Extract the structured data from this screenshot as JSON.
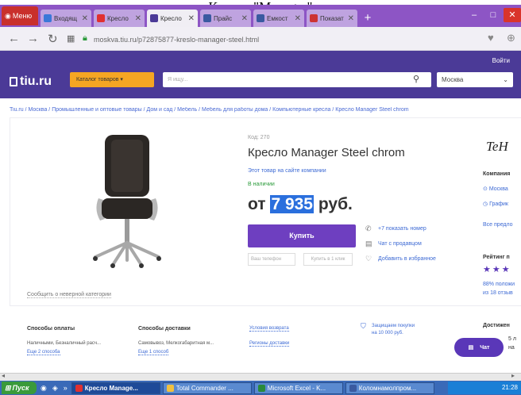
{
  "caption": "Кресло \"Manager\"",
  "browser": {
    "menu_label": "Меню",
    "tabs": [
      {
        "label": "Входящ",
        "active": false,
        "color": "#3b78d8"
      },
      {
        "label": "Кресло",
        "active": false,
        "color": "#e03030"
      },
      {
        "label": "Кресло",
        "active": true,
        "color": "#4b3a97"
      },
      {
        "label": "Прайс",
        "active": false,
        "color": "#3a5aa0"
      },
      {
        "label": "Емкост",
        "active": false,
        "color": "#3a5aa0"
      },
      {
        "label": "Показат",
        "active": false,
        "color": "#cc3333"
      }
    ],
    "new_tab": "+",
    "url": "moskva.tiu.ru/p72875877-kreslo-manager-steel.html"
  },
  "site": {
    "login": "Войти",
    "logo": "tiu.ru",
    "catalog_label": "Каталог товаров",
    "search_placeholder": "Я ищу...",
    "city": "Москва",
    "breadcrumb": "Tiu.ru / Москва / Промышленные и оптовые товары / Дом и сад / Мебель / Мебель для работы дома / Компьютерные кресла / Кресло Manager Steel chrom"
  },
  "product": {
    "code": "Код: 270",
    "title": "Кресло Manager Steel chrom",
    "on_site": "Этот товар на сайте компании",
    "availability": "В наличии",
    "price_prefix": "от",
    "price_value": "7 935",
    "price_currency": "руб.",
    "buy_label": "Купить",
    "phone_placeholder": "Ваш телефон",
    "one_click": "Купить в 1 клик",
    "actions": [
      {
        "icon": "phone-icon",
        "glyph": "✆",
        "label": "+7 показать номер"
      },
      {
        "icon": "chat-icon",
        "glyph": "▤",
        "label": "Чат с продавцом"
      },
      {
        "icon": "heart-icon",
        "glyph": "♡",
        "label": "Добавить в избранное"
      }
    ],
    "report": "Сообщить о неверной категории"
  },
  "sidebar": {
    "company_label": "Компания",
    "city_link": "Москва",
    "schedule_link": "График",
    "all_offers": "Все предло",
    "rating_label": "Рейтинг п",
    "stars": "★★★",
    "positive": "88% положи",
    "reviews": "из 18 отзыв",
    "achievements": "Достижен",
    "ach_line1": "5 л",
    "ach_line2": "на"
  },
  "bottom": {
    "payment_title": "Способы оплаты",
    "payment_text": "Наличными, Безналичный расч...",
    "payment_more": "Еще 2 способа",
    "delivery_title": "Способы доставки",
    "delivery_text": "Самовывоз, Мелкогабаритная м...",
    "delivery_more": "Еще 1 способ",
    "return_link": "Условия возврата",
    "regions_link": "Регионы доставки",
    "protect_line1": "Защищаем покупки",
    "protect_line2": "на 10 000 руб."
  },
  "chat_label": "Чат",
  "taskbar": {
    "start": "Пуск",
    "items": [
      {
        "label": "Кресло Manage...",
        "active": true,
        "color": "#e03030"
      },
      {
        "label": "Total Commander ...",
        "active": false,
        "color": "#f0c040"
      },
      {
        "label": "Microsoft Excel - K...",
        "active": false,
        "color": "#2a8a3a"
      },
      {
        "label": "Коломнамолпром...",
        "active": false,
        "color": "#3a5aa0"
      }
    ],
    "clock": "21:28"
  }
}
